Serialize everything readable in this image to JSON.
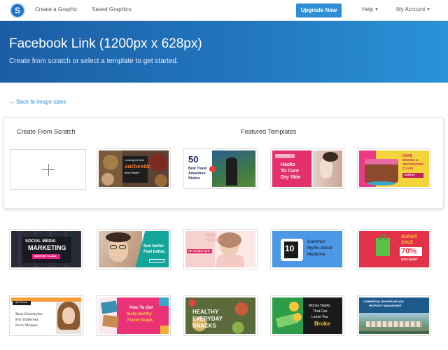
{
  "nav": {
    "logo_letter": "S",
    "create_link": "Create a Graphic",
    "saved_link": "Saved Graphics",
    "upgrade_button": "Upgrade Now",
    "help_menu": "Help",
    "account_menu": "My Account"
  },
  "hero": {
    "title": "Facebook Link (1200px x 628px)",
    "subtitle": "Create from scratch or select a template to get started."
  },
  "back_link": "← Back to image sizes",
  "card": {
    "scratch_heading": "Create From Scratch",
    "featured_heading": "Featured Templates"
  },
  "templates": {
    "t1": {
      "line1": "Looking for that",
      "line2": "authentic",
      "line3": "asian taste?"
    },
    "t2": {
      "num": "50",
      "line1": "Best Travel",
      "line2": "Adventure",
      "line3": "Stories"
    },
    "t3": {
      "tag": "Beauty Tips",
      "line1": "Hacks",
      "line2": "To Cure",
      "line3": "Dry Skin"
    },
    "t4": {
      "line1": "CAKE",
      "line2": "BAKING &",
      "line3": "DECORATING",
      "line4": "CLASS",
      "price": "$499.00"
    },
    "t5": {
      "line1": "SOCIAL MEDIA",
      "line2": "MARKETING",
      "line3": "MASTER CLASS"
    },
    "t6": {
      "line1": "See better.",
      "line2": "Feel better."
    },
    "t7": {
      "line1": "PINK",
      "line2": "FASHION",
      "line3": "UP TO 50% OFF"
    },
    "t8": {
      "num": "10",
      "line1": "Common",
      "line2": "Myths About",
      "line3": "Medicine"
    },
    "t9": {
      "line1": "SUPER",
      "line2": "SALE",
      "line3": "70%",
      "line4": "DISCOUNT"
    },
    "t10": {
      "tag": "Hair Trends",
      "line1": "Best Hairstyles",
      "line2": "For Different",
      "line3": "Face Shapes"
    },
    "t11": {
      "line1": "How To Get",
      "line2": "Insta-worthy",
      "line3": "Travel Snaps"
    },
    "t12": {
      "line1": "HEALTHY",
      "line2": "EVERYDAY",
      "line3": "SNACKS"
    },
    "t13": {
      "line1": "Money Habits",
      "line2": "That Can",
      "line3": "Leave You",
      "line4": "Broke"
    },
    "t14": {
      "line1": "COMMERCIAL BROKERAGE AND",
      "line2": "PROPERTY MANAGEMENT"
    }
  },
  "colors": {
    "accent": "#2d8ed6",
    "hero_start": "#1b5da4",
    "hero_end": "#2a92d6"
  }
}
